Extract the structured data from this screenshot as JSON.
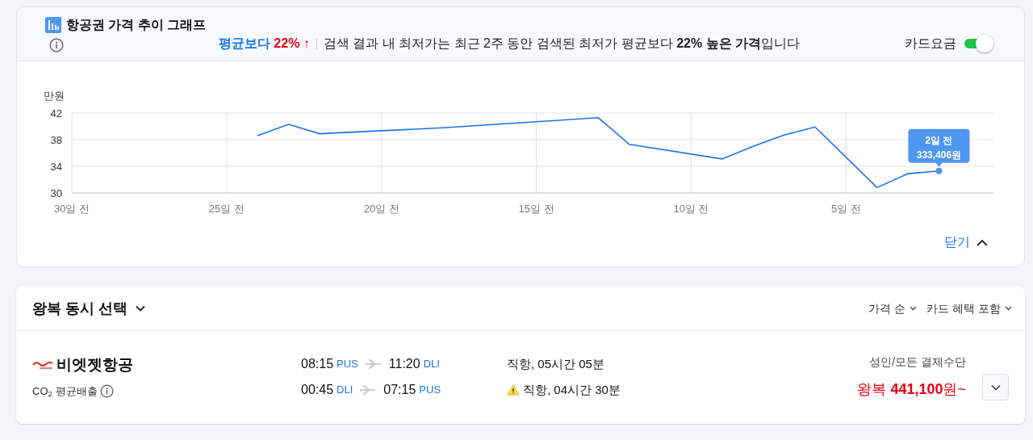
{
  "price_trend": {
    "title": "항공권 가격 추이 그래프",
    "badge_label": "평균보다",
    "badge_value": "22%",
    "badge_arrow": "↑",
    "summary": "검색 결과 내 최저가는 최근 2주 동안 검색된 최저가 평균보다 **22% 높은 가격**입니다",
    "card_fare": {
      "label": "카드요금",
      "on": true
    },
    "chart_data": {
      "type": "line",
      "ylabel": "만원",
      "x": [
        24,
        23,
        22,
        18,
        13,
        12,
        9,
        8,
        7,
        6,
        4,
        3,
        2
      ],
      "series": [
        {
          "color": "#1a73e8",
          "values": [
            38.6,
            40.3,
            38.9,
            39.8,
            41.3,
            37.3,
            35.1,
            37.0,
            38.7,
            39.9,
            30.8,
            32.9,
            33.3
          ]
        }
      ],
      "grid": true,
      "xlim": [
        30,
        0.24
      ],
      "ylim": [
        30,
        42
      ],
      "xticks": [
        {
          "value": 30,
          "label": "30일 전"
        },
        {
          "value": 25,
          "label": "25일 전"
        },
        {
          "value": 20,
          "label": "20일 전"
        },
        {
          "value": 15,
          "label": "15일 전"
        },
        {
          "value": 10,
          "label": "10일 전"
        },
        {
          "value": 5,
          "label": "5일 전"
        }
      ],
      "yticks": [
        30,
        34,
        38,
        42
      ],
      "annotations": [
        {
          "text": "2일 전\n333,406원"
        }
      ]
    },
    "collapse_label": "닫기"
  },
  "results": {
    "title": "왕복 동시 선택",
    "sort_options": [
      "가격 순",
      "카드 혜택 포함"
    ],
    "flights": [
      {
        "airline": "비엣젯항공",
        "co2_label": "CO$_{2}$ 평균배출",
        "legs": [
          {
            "depart_time": "08:15",
            "depart_airport": "PUS",
            "arrive_time": "11:20",
            "arrive_airport": "DLI",
            "duration": "직항, 05시간 05분",
            "warning": false
          },
          {
            "depart_time": "00:45",
            "depart_airport": "DLI",
            "arrive_time": "07:15",
            "arrive_airport": "PUS",
            "duration": "직항, 04시간 30분",
            "warning": true
          }
        ],
        "fare_label": "성인/모든 결제수단",
        "price": "왕복 **441,100**원~"
      }
    ]
  }
}
